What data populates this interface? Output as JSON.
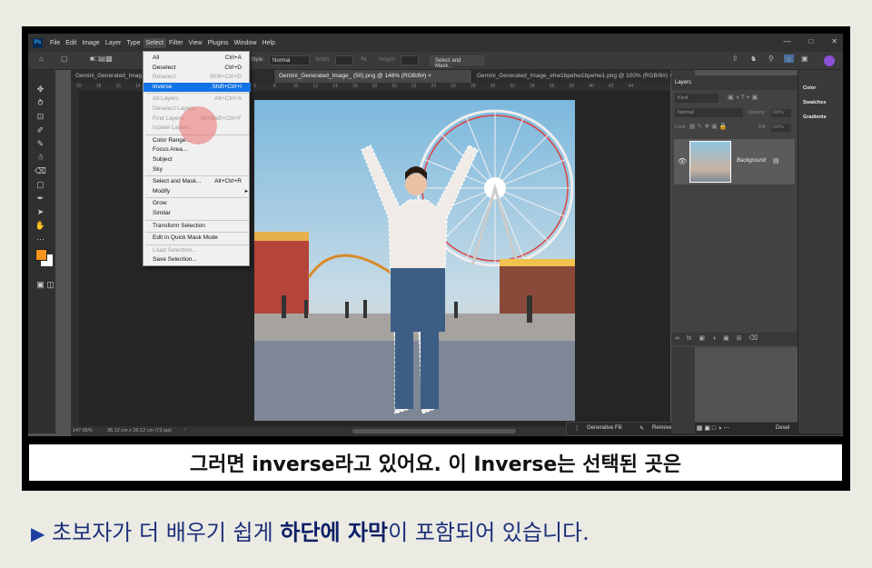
{
  "menubar": {
    "logo": "Ps",
    "items": [
      "File",
      "Edit",
      "Image",
      "Layer",
      "Type",
      "Select",
      "Filter",
      "View",
      "Plugins",
      "Window",
      "Help"
    ],
    "active": "Select"
  },
  "options": {
    "style_label": "Style:",
    "style_value": "Normal",
    "width_label": "Width:",
    "height_label": "Height:",
    "select_mask_button": "Select and Mask..."
  },
  "tabs": [
    {
      "label": "Gemini_Generated_Imag",
      "active": false
    },
    {
      "label": "Gemini_Generated_Image_ (50).png @ 148% (RGB/8#)",
      "active": true
    },
    {
      "label": "Gemini_Generated_Image_ehw1bpehw1bpehw1.png @ 100% (RGB/8#)",
      "active": false
    }
  ],
  "ruler_ticks": [
    "20",
    "18",
    "16",
    "14",
    "4",
    "2",
    "0",
    "2",
    "4",
    "6",
    "8",
    "10",
    "12",
    "14",
    "16",
    "18",
    "20",
    "22",
    "24",
    "26",
    "28",
    "30",
    "32",
    "34",
    "36",
    "38",
    "40",
    "42",
    "44"
  ],
  "select_menu": [
    {
      "label": "All",
      "shortcut": "Ctrl+A",
      "disabled": false
    },
    {
      "label": "Deselect",
      "shortcut": "Ctrl+D",
      "disabled": false
    },
    {
      "label": "Reselect",
      "shortcut": "Shift+Ctrl+D",
      "disabled": true
    },
    {
      "label": "Inverse",
      "shortcut": "Shift+Ctrl+I",
      "highlight": true
    },
    {
      "sep": true
    },
    {
      "label": "All Layers",
      "shortcut": "Alt+Ctrl+A",
      "disabled": true
    },
    {
      "label": "Deselect Layers",
      "shortcut": "",
      "disabled": true
    },
    {
      "label": "Find Layers",
      "shortcut": "Alt+Shift+Ctrl+F",
      "disabled": true
    },
    {
      "label": "Isolate Layers",
      "shortcut": "",
      "disabled": true
    },
    {
      "sep": true
    },
    {
      "label": "Color Range...",
      "shortcut": "",
      "disabled": false
    },
    {
      "label": "Focus Area...",
      "shortcut": "",
      "disabled": false
    },
    {
      "label": "Subject",
      "shortcut": "",
      "disabled": false
    },
    {
      "label": "Sky",
      "shortcut": "",
      "disabled": false
    },
    {
      "sep": true
    },
    {
      "label": "Select and Mask...",
      "shortcut": "Alt+Ctrl+R",
      "disabled": false
    },
    {
      "label": "Modify",
      "shortcut": "",
      "disabled": false,
      "submenu": true
    },
    {
      "sep": true
    },
    {
      "label": "Grow",
      "shortcut": "",
      "disabled": false
    },
    {
      "label": "Similar",
      "shortcut": "",
      "disabled": false
    },
    {
      "sep": true
    },
    {
      "label": "Transform Selection",
      "shortcut": "",
      "disabled": false
    },
    {
      "sep": true
    },
    {
      "label": "Edit in Quick Mask Mode",
      "shortcut": "",
      "disabled": false
    },
    {
      "sep": true
    },
    {
      "label": "Load Selection...",
      "shortcut": "",
      "disabled": true
    },
    {
      "label": "Save Selection...",
      "shortcut": "",
      "disabled": false
    }
  ],
  "status": {
    "zoom": "147.66%",
    "doc_size": "36.12 cm x 36.12 cm (72 ppi)"
  },
  "context_bar": {
    "generative_fill": "Generative Fill",
    "remove": "Remove",
    "deselect": "Desel"
  },
  "layers_panel": {
    "title": "Layers",
    "kind": "Kind",
    "blend_mode": "Normal",
    "opacity_label": "Opacity:",
    "opacity_value": "100%",
    "lock_label": "Lock:",
    "fill_label": "Fill:",
    "fill_value": "100%",
    "layer_name": "Background"
  },
  "right_panel": [
    "Color",
    "Swatches",
    "Gradients"
  ],
  "caption": "그러면 inverse라고 있어요. 이 Inverse는 선택된 곳은",
  "bottom_text": {
    "prefix": "초보자가 더 배우기 쉽게 ",
    "bold": "하단에 자막",
    "suffix": "이 포함되어 있습니다."
  },
  "colors": {
    "foreground": "#f7941d",
    "background": "#ffffff",
    "highlight": "#1473e6",
    "bottom_text": "#1c2f7a"
  }
}
